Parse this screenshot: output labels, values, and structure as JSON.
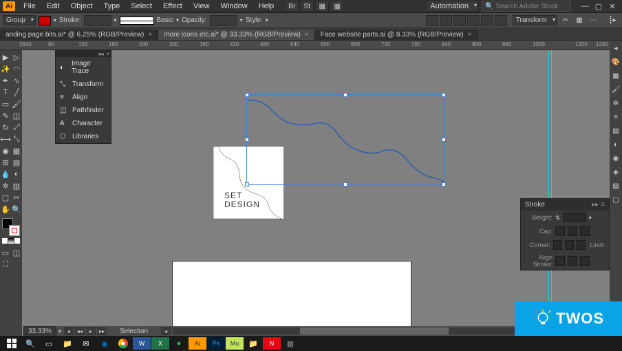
{
  "app": {
    "icon_label": "Ai"
  },
  "menu": {
    "items": [
      "File",
      "Edit",
      "Object",
      "Type",
      "Select",
      "Effect",
      "View",
      "Window",
      "Help"
    ],
    "icon_buttons": [
      "Br",
      "St",
      "▦",
      "▦"
    ],
    "automation": "Automation",
    "search_placeholder": "Search Adobe Stock"
  },
  "control": {
    "group_label": "Group",
    "stroke_label": "Stroke:",
    "basic_label": "Basic",
    "opacity_label": "Opacity:",
    "style_label": "Style:",
    "transform_label": "Transform"
  },
  "tabs": [
    {
      "label": "anding page bits.ai* @ 6.25% (RGB/Preview)",
      "active": false
    },
    {
      "label": "more icons etc.ai* @ 33.33% (RGB/Preview)",
      "active": true
    },
    {
      "label": "Face website parts.ai @ 8.33% (RGB/Preview)",
      "active": false
    }
  ],
  "ruler": {
    "marks": [
      "2640",
      "60",
      "120",
      "180",
      "240",
      "300",
      "360",
      "420",
      "480",
      "540",
      "600",
      "660",
      "720",
      "780",
      "840",
      "900",
      "960",
      "1020",
      "1200",
      "1260"
    ]
  },
  "canvas": {
    "set_text_line1": "SET",
    "set_text_line2": "DESIGN"
  },
  "floating_panel": {
    "items": [
      {
        "icon": "◐",
        "label": "Image Trace"
      },
      {
        "icon": "⤡",
        "label": "Transform"
      },
      {
        "icon": "≡",
        "label": "Align"
      },
      {
        "icon": "◫",
        "label": "Pathfinder"
      },
      {
        "icon": "A",
        "label": "Character"
      },
      {
        "icon": "⬡",
        "label": "Libraries"
      }
    ]
  },
  "stroke_panel": {
    "title": "Stroke",
    "weight_label": "Weight:",
    "cap_label": "Cap:",
    "corner_label": "Corner:",
    "align_label": "Align Stroke:",
    "limit_label": "Limit:"
  },
  "status": {
    "zoom": "33.33%",
    "mode": "Selection"
  },
  "twos": {
    "text": "TWOS"
  }
}
